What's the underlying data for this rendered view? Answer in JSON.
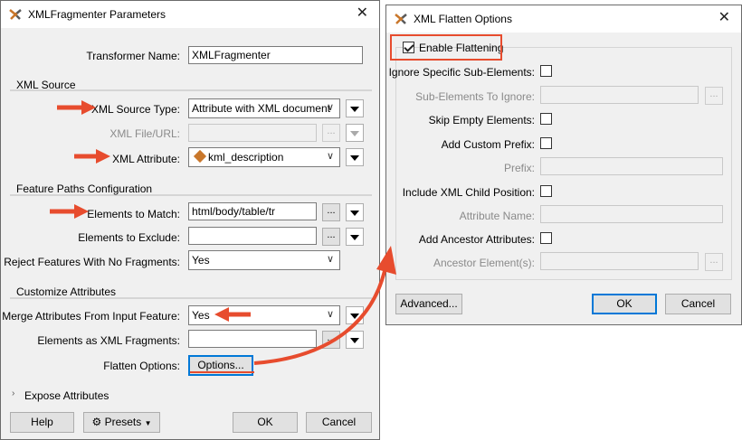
{
  "left": {
    "title": "XMLFragmenter Parameters",
    "transformer_name_label": "Transformer Name:",
    "transformer_name_value": "XMLFragmenter",
    "xml_source": {
      "group_title": "XML Source",
      "source_type_label": "XML Source Type:",
      "source_type_value": "Attribute with XML document",
      "file_url_label": "XML File/URL:",
      "xml_attribute_label": "XML Attribute:",
      "xml_attribute_value": "kml_description"
    },
    "feature_paths": {
      "group_title": "Feature Paths Configuration",
      "match_label": "Elements to Match:",
      "match_value": "html/body/table/tr",
      "exclude_label": "Elements to Exclude:",
      "exclude_value": "",
      "reject_label": "Reject Features With No Fragments:",
      "reject_value": "Yes"
    },
    "customize": {
      "group_title": "Customize Attributes",
      "merge_label": "Merge Attributes From Input Feature:",
      "merge_value": "Yes",
      "fragments_label": "Elements as XML Fragments:",
      "fragments_value": "",
      "flatten_label": "Flatten Options:",
      "flatten_button": "Options..."
    },
    "expose_label": "Expose Attributes",
    "help_button": "Help",
    "presets_button": "Presets",
    "ok_button": "OK",
    "cancel_button": "Cancel",
    "ellipsis": "..."
  },
  "right": {
    "title": "XML Flatten Options",
    "enable_label": "Enable Flattening",
    "enable_checked": true,
    "ignore_label": "Ignore Specific Sub-Elements:",
    "sub_elements_label": "Sub-Elements To Ignore:",
    "skip_empty_label": "Skip Empty Elements:",
    "custom_prefix_label": "Add Custom Prefix:",
    "prefix_label": "Prefix:",
    "child_position_label": "Include XML Child Position:",
    "attribute_name_label": "Attribute Name:",
    "ancestor_attrs_label": "Add Ancestor Attributes:",
    "ancestor_elements_label": "Ancestor Element(s):",
    "advanced_button": "Advanced...",
    "ok_button": "OK",
    "cancel_button": "Cancel",
    "ellipsis": "..."
  },
  "colors": {
    "annotation": "#e74c2e",
    "accent": "#0078d7"
  }
}
